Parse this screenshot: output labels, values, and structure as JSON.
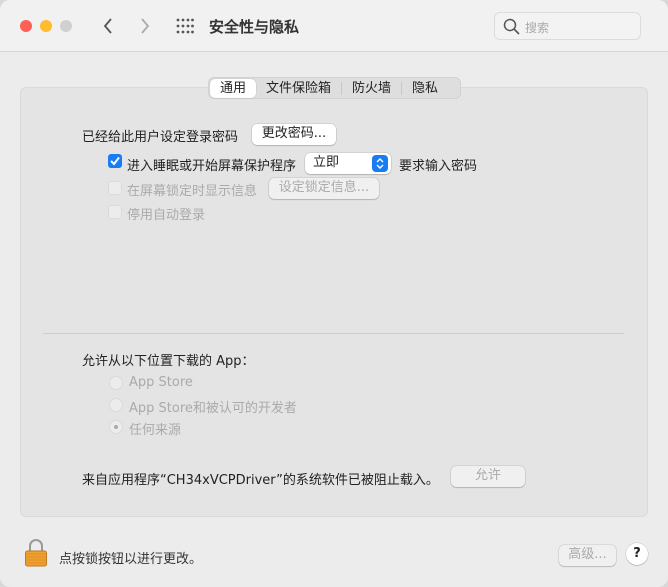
{
  "window": {
    "title": "安全性与隐私",
    "search_placeholder": "搜索",
    "colors": {
      "close": "#fe5f57",
      "minimize": "#febc2e",
      "zoom": "#d0d0d0",
      "accent": "#1a7cf5",
      "lock": "#f0a030"
    }
  },
  "tabs": [
    {
      "label": "通用",
      "active": true
    },
    {
      "label": "文件保险箱"
    },
    {
      "label": "防火墙"
    },
    {
      "label": "隐私"
    }
  ],
  "general": {
    "password_label": "已经给此用户设定登录密码",
    "change_password_button": "更改密码...",
    "require_password": {
      "label": "进入睡眠或开始屏幕保护程序",
      "checked": true,
      "select_value": "立即",
      "suffix": "要求输入密码"
    },
    "show_message": {
      "label": "在屏幕锁定时显示信息",
      "checked": false,
      "button": "设定锁定信息..."
    },
    "disable_autologin": {
      "label": "停用自动登录",
      "checked": false
    }
  },
  "downloads": {
    "label": "允许从以下位置下载的 App：",
    "options": [
      {
        "label": "App Store",
        "selected": false
      },
      {
        "label": "App Store和被认可的开发者",
        "selected": false
      },
      {
        "label": "任何来源",
        "selected": true
      }
    ]
  },
  "blocked": {
    "message": "来自应用程序“CH34xVCPDriver”的系统软件已被阻止载入。",
    "allow_button": "允许"
  },
  "footer": {
    "lock_text": "点按锁按钮以进行更改。",
    "advanced_button": "高级...",
    "help_button": "?"
  }
}
